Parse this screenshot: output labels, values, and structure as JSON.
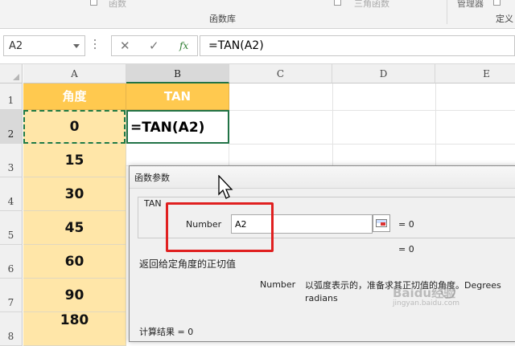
{
  "ribbon": {
    "faded_left": "函数",
    "group_label_functions": "函数库",
    "faded_right": "三角函数",
    "manager_label": "管理器",
    "define_label": "定义"
  },
  "formula_bar": {
    "name_box": "A2",
    "formula": "=TAN(A2)",
    "fx_label": "fx"
  },
  "grid": {
    "columns": [
      "A",
      "B",
      "C",
      "D",
      "E"
    ],
    "rows": [
      "1",
      "2",
      "3",
      "4",
      "5",
      "6",
      "7",
      "8"
    ],
    "header_a": "角度",
    "header_b": "TAN",
    "angles": [
      "0",
      "15",
      "30",
      "45",
      "60",
      "90",
      "180"
    ],
    "edit_cell": "=TAN(A2)"
  },
  "dialog": {
    "title": "函数参数",
    "function_name": "TAN",
    "arg_label": "Number",
    "arg_value": "A2",
    "arg_result": "=  0",
    "result_line": "=  0",
    "description": "返回给定角度的正切值",
    "param_name": "Number",
    "param_desc": "以弧度表示的，准备求其正切值的角度。Degrees radians",
    "calc_result": "计算结果  =  0"
  },
  "watermark": {
    "text": "Baidu经验",
    "sub": "jingyan.baidu.com"
  }
}
